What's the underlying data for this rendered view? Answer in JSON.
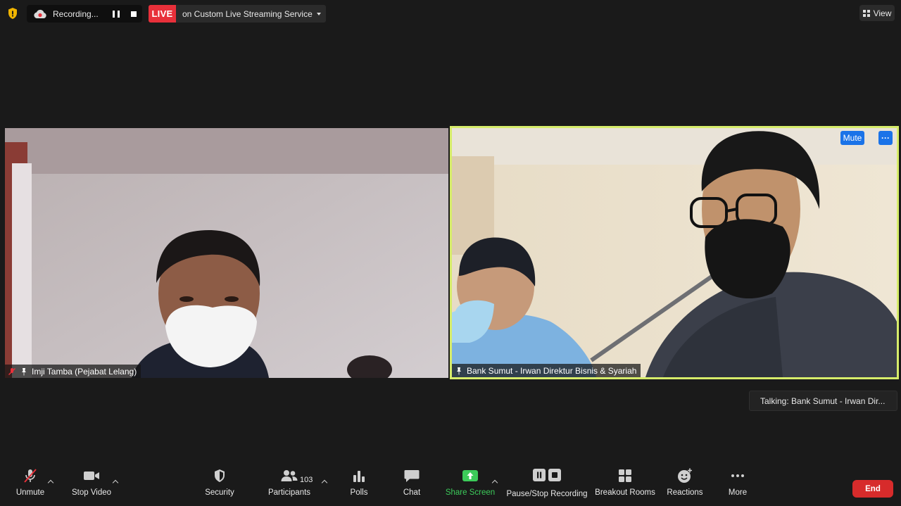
{
  "top_bar": {
    "recording_status": "Recording...",
    "live_badge": "LIVE",
    "live_text": "on Custom Live Streaming Service",
    "view_label": "View"
  },
  "participants": [
    {
      "name": "Imji Tamba (Pejabat Lelang)",
      "muted": true,
      "pinned": true
    },
    {
      "name": "Bank Sumut - Irwan Direktur Bisnis & Syariah",
      "muted": false,
      "pinned": true,
      "active_speaker": true
    }
  ],
  "tile_actions": {
    "mute_label": "Mute",
    "more_label": "···"
  },
  "talking_indicator": "Talking: Bank Sumut - Irwan Dir...",
  "toolbar": {
    "unmute": "Unmute",
    "stop_video": "Stop Video",
    "security": "Security",
    "participants": "Participants",
    "participants_count": "103",
    "polls": "Polls",
    "chat": "Chat",
    "share_screen": "Share Screen",
    "recording": "Pause/Stop Recording",
    "breakout": "Breakout Rooms",
    "reactions": "Reactions",
    "more": "More",
    "end": "End"
  },
  "colors": {
    "background": "#1a1a1a",
    "active_speaker_border": "#d6ec6a",
    "live_red": "#e8303a",
    "end_red": "#d72b2b",
    "accent_blue": "#1a73e8",
    "share_green": "#3ccb5a",
    "security_shield": "#f0b400"
  },
  "icons": {
    "encryption": "shield-icon",
    "cloud_recording": "cloud-icon",
    "mic": "mic-muted-icon",
    "video": "video-camera-icon",
    "security": "security-shield-icon",
    "participants": "people-icon",
    "polls": "bar-chart-icon",
    "chat": "chat-bubble-icon",
    "share": "share-arrow-icon",
    "recording": "pause-stop-icon",
    "breakout": "grid-icon",
    "reactions": "smiley-plus-icon",
    "more": "ellipsis-icon"
  }
}
